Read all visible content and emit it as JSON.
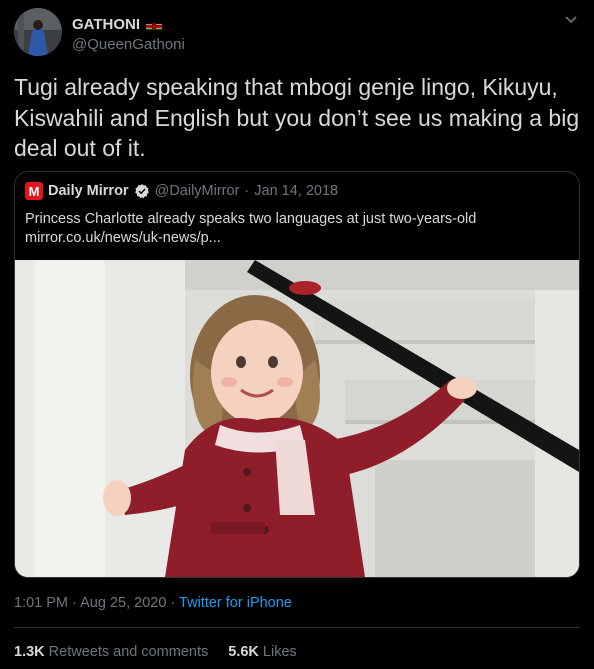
{
  "author": {
    "display_name": "GATHONI",
    "handle": "@QueenGathoni",
    "flag_icon": "kenya-flag-icon"
  },
  "tweet": {
    "text": "Tugi already speaking that mbogi genje lingo, Kikuyu, Kiswahili and English but you don’t see us making a big deal out of it."
  },
  "quoted": {
    "logo_letter": "M",
    "name": "Daily Mirror",
    "handle": "@DailyMirror",
    "separator": "·",
    "date": "Jan 14, 2018",
    "text": "Princess Charlotte already speaks two languages at just two-years-old",
    "link": "mirror.co.uk/news/uk-news/p...",
    "image_icon": "child-photo"
  },
  "meta": {
    "time": "1:01 PM",
    "separator": "·",
    "date": "Aug 25, 2020",
    "separator2": "·",
    "source": "Twitter for iPhone"
  },
  "stats": {
    "retweets_count": "1.3K",
    "retweets_label": "Retweets and comments",
    "likes_count": "5.6K",
    "likes_label": "Likes"
  },
  "colors": {
    "background": "#000000",
    "text": "#d9d9d9",
    "muted": "#6e767d",
    "link": "#1d9bf0",
    "border": "#2f3336",
    "mirror_red": "#e2141c"
  }
}
